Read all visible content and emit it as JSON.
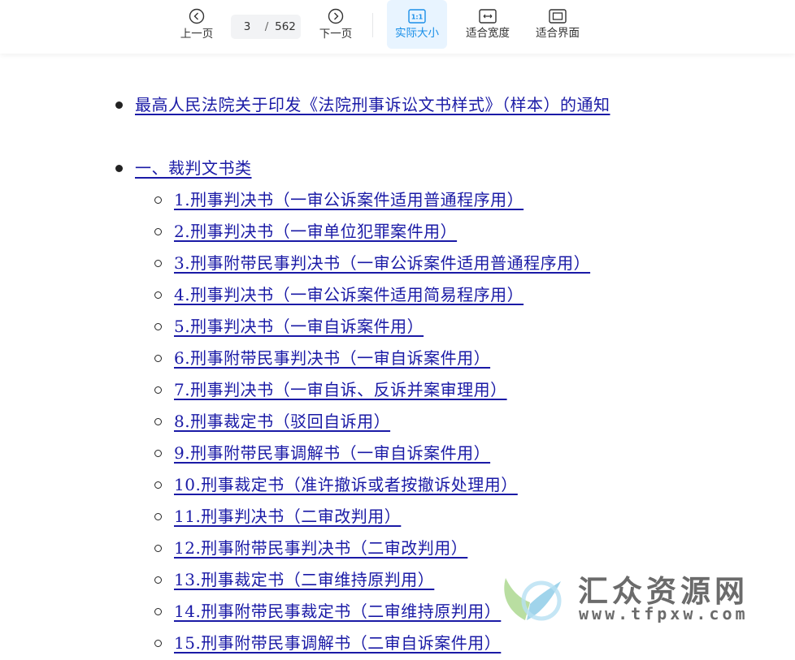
{
  "toolbar": {
    "prev_label": "上一页",
    "next_label": "下一页",
    "current_page": "3",
    "page_separator": "/",
    "total_pages": "562",
    "actual_size_label": "实际大小",
    "actual_size_icon_text": "1:1",
    "fit_width_label": "适合宽度",
    "fit_page_label": "适合界面",
    "accent_color": "#1a8fe8"
  },
  "document": {
    "top_items": [
      "最高人民法院关于印发《法院刑事诉讼文书样式》（样本）的通知",
      "一、裁判文书类"
    ],
    "sub_items": [
      "1.刑事判决书（一审公诉案件适用普通程序用）",
      "2.刑事判决书（一审单位犯罪案件用）",
      "3.刑事附带民事判决书（一审公诉案件适用普通程序用）",
      "4.刑事判决书（一审公诉案件适用简易程序用）",
      "5.刑事判决书（一审自诉案件用）",
      "6.刑事附带民事判决书（一审自诉案件用）",
      "7.刑事判决书（一审自诉、反诉并案审理用）",
      "8.刑事裁定书（驳回自诉用）",
      "9.刑事附带民事调解书（一审自诉案件用）",
      "10.刑事裁定书（准许撤诉或者按撤诉处理用）",
      "11.刑事判决书（二审改判用）",
      "12.刑事附带民事判决书（二审改判用）",
      "13.刑事裁定书（二审维持原判用）",
      "14.刑事附带民事裁定书（二审维持原判用）",
      "15.刑事附带民事调解书（二审自诉案件用）"
    ],
    "link_color": "#1a1aa6"
  },
  "watermark": {
    "title": "汇众资源网",
    "url": "www.tfpxw.com"
  }
}
